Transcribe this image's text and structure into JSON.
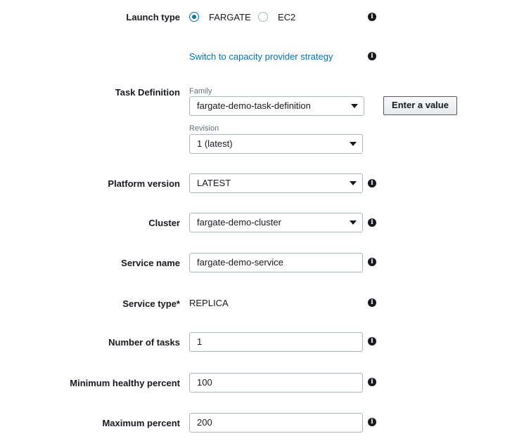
{
  "launch_type": {
    "label": "Launch type",
    "options": [
      {
        "label": "FARGATE",
        "selected": true
      },
      {
        "label": "EC2",
        "selected": false
      }
    ]
  },
  "capacity_provider_link": "Switch to capacity provider strategy",
  "task_definition": {
    "label": "Task Definition",
    "family_label": "Family",
    "family_value": "fargate-demo-task-definition",
    "revision_label": "Revision",
    "revision_value": "1 (latest)",
    "enter_value_button": "Enter a value"
  },
  "platform_version": {
    "label": "Platform version",
    "value": "LATEST"
  },
  "cluster": {
    "label": "Cluster",
    "value": "fargate-demo-cluster"
  },
  "service_name": {
    "label": "Service name",
    "value": "fargate-demo-service"
  },
  "service_type": {
    "label": "Service type*",
    "value": "REPLICA"
  },
  "number_of_tasks": {
    "label": "Number of tasks",
    "value": "1"
  },
  "min_healthy_percent": {
    "label": "Minimum healthy percent",
    "value": "100"
  },
  "max_percent": {
    "label": "Maximum percent",
    "value": "200"
  },
  "info_icon_glyph": "i",
  "colors": {
    "link": "#0073bb",
    "radio_selected": "#0073bb",
    "field_border": "#aab7b8",
    "text": "#16191f",
    "sublabel": "#687078"
  }
}
